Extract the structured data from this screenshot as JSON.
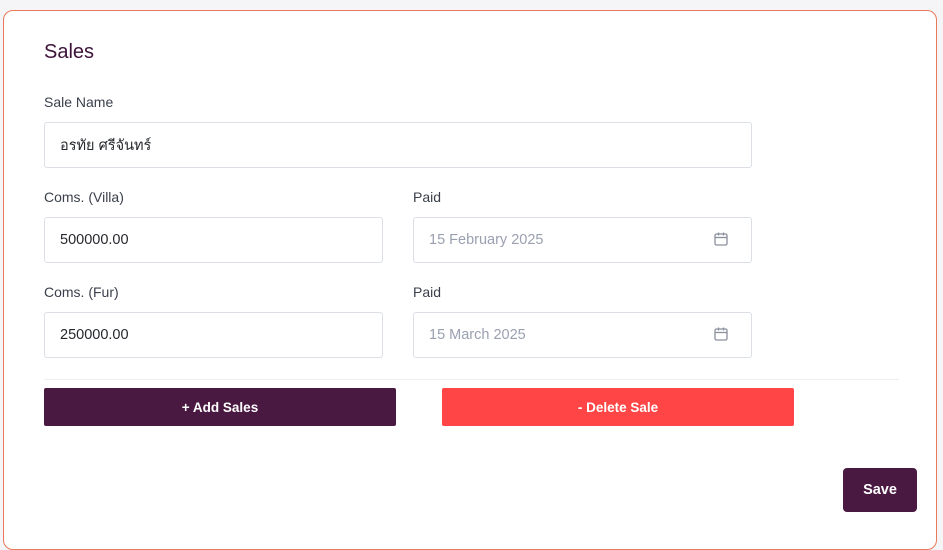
{
  "card": {
    "title": "Sales"
  },
  "sale_name": {
    "label": "Sale Name",
    "value": "อรทัย ศรีจันทร์"
  },
  "coms_villa": {
    "label": "Coms. (Villa)",
    "value": "500000.00"
  },
  "paid_villa": {
    "label": "Paid",
    "value": "15 February 2025"
  },
  "coms_fur": {
    "label": "Coms. (Fur)",
    "value": "250000.00"
  },
  "paid_fur": {
    "label": "Paid",
    "value": "15 March 2025"
  },
  "actions": {
    "add_label": "+ Add Sales",
    "delete_label": "- Delete Sale",
    "save_label": "Save"
  },
  "colors": {
    "primary": "#4a1942",
    "danger": "#ff4545",
    "card_border": "#e8795a"
  },
  "icons": {
    "date_picker": "calendar-icon"
  }
}
